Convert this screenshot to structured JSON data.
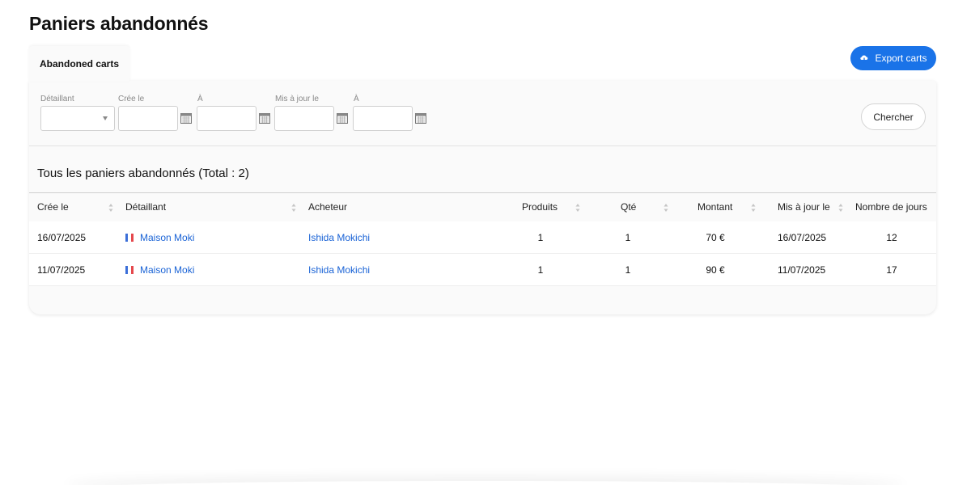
{
  "page": {
    "title": "Paniers abandonnés"
  },
  "tabs": [
    {
      "label": "Abandoned carts"
    }
  ],
  "toolbar": {
    "export_label": "Export carts"
  },
  "filters": {
    "retailer_label": "Détaillant",
    "created_label": "Crée le",
    "to_label": "À",
    "updated_label": "Mis à jour le",
    "to2_label": "À",
    "retailer_value": "",
    "created_from": "",
    "created_to": "",
    "updated_from": "",
    "updated_to": "",
    "search_label": "Chercher"
  },
  "list": {
    "title": "Tous les paniers abandonnés (Total : 2)",
    "columns": [
      "Crée le",
      "Détaillant",
      "Acheteur",
      "Produits",
      "Qté",
      "Montant",
      "Mis à jour le",
      "Nombre de jours"
    ],
    "rows": [
      {
        "created": "16/07/2025",
        "retailer": "Maison Moki",
        "buyer": "Ishida Mokichi",
        "products": "1",
        "qty": "1",
        "amount": "70 €",
        "updated": "16/07/2025",
        "days": "12"
      },
      {
        "created": "11/07/2025",
        "retailer": "Maison Moki",
        "buyer": "Ishida Mokichi",
        "products": "1",
        "qty": "1",
        "amount": "90 €",
        "updated": "11/07/2025",
        "days": "17"
      }
    ]
  },
  "colors": {
    "accent": "#1a73e8",
    "link": "#1a63d6",
    "flag_blue": "#3b6fd8",
    "flag_white": "#ffffff",
    "flag_red": "#e5484d"
  },
  "icons": {
    "export": "cloud-download-icon",
    "calendar": "calendar-icon",
    "sort": "sort-icon",
    "flag": "france-flag-icon"
  }
}
